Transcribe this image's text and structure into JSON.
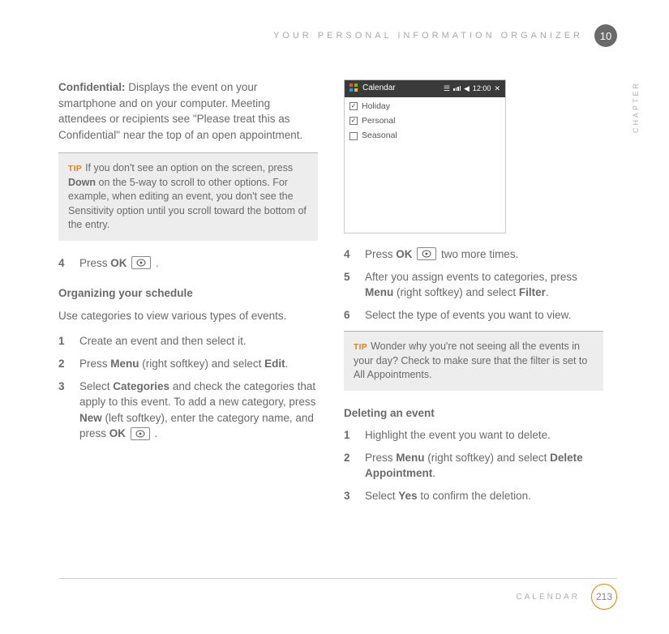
{
  "header": {
    "title": "YOUR PERSONAL INFORMATION ORGANIZER",
    "chapter_num": "10",
    "chapter_label": "CHAPTER"
  },
  "footer": {
    "section": "CALENDAR",
    "page": "213"
  },
  "left": {
    "confidential_label": "Confidential:",
    "confidential_text": " Displays the event on your smartphone and on your computer. Meeting attendees or recipients see \"Please treat this as Confidential\" near the top of an open appointment.",
    "tip_label": "TIP",
    "tip1_a": "If you don't see an option on the screen, press ",
    "tip1_bold": "Down",
    "tip1_b": " on the 5-way to scroll to other options. For example, when editing an event, you don't see the Sensitivity option until you scroll toward the bottom of the entry.",
    "step4_num": "4",
    "step4_a": "Press ",
    "step4_bold": "OK",
    "step4_b": " .",
    "subhead1": "Organizing your schedule",
    "para1": "Use categories to view various types of events.",
    "s1_num": "1",
    "s1_text": "Create an event and then select it.",
    "s2_num": "2",
    "s2_a": "Press ",
    "s2_bold1": "Menu",
    "s2_b": " (right softkey) and select ",
    "s2_bold2": "Edit",
    "s2_c": ".",
    "s3_num": "3",
    "s3_a": "Select ",
    "s3_bold1": "Categories",
    "s3_b": " and check the categories that apply to this event. To add a new category, press ",
    "s3_bold2": "New",
    "s3_c": " (left softkey), enter the category name, and press ",
    "s3_bold3": "OK",
    "s3_d": " ."
  },
  "right": {
    "shot": {
      "title": "Calendar",
      "time": "12:00",
      "items": [
        {
          "label": "Holiday",
          "checked": true
        },
        {
          "label": "Personal",
          "checked": true
        },
        {
          "label": "Seasonal",
          "checked": false
        }
      ]
    },
    "s4_num": "4",
    "s4_a": "Press ",
    "s4_bold": "OK",
    "s4_b": " two more times.",
    "s5_num": "5",
    "s5_a": "After you assign events to categories, press ",
    "s5_bold1": "Menu",
    "s5_b": " (right softkey) and select ",
    "s5_bold2": "Filter",
    "s5_c": ".",
    "s6_num": "6",
    "s6_text": "Select the type of events you want to view.",
    "tip_label": "TIP",
    "tip2": "Wonder why you're not seeing all the events in your day? Check to make sure that the filter is set to All Appointments.",
    "subhead2": "Deleting an event",
    "d1_num": "1",
    "d1_text": "Highlight the event you want to delete.",
    "d2_num": "2",
    "d2_a": "Press ",
    "d2_bold1": "Menu",
    "d2_b": " (right softkey) and select ",
    "d2_bold2": "Delete Appointment",
    "d2_c": ".",
    "d3_num": "3",
    "d3_a": "Select ",
    "d3_bold": "Yes",
    "d3_b": " to confirm the deletion."
  }
}
